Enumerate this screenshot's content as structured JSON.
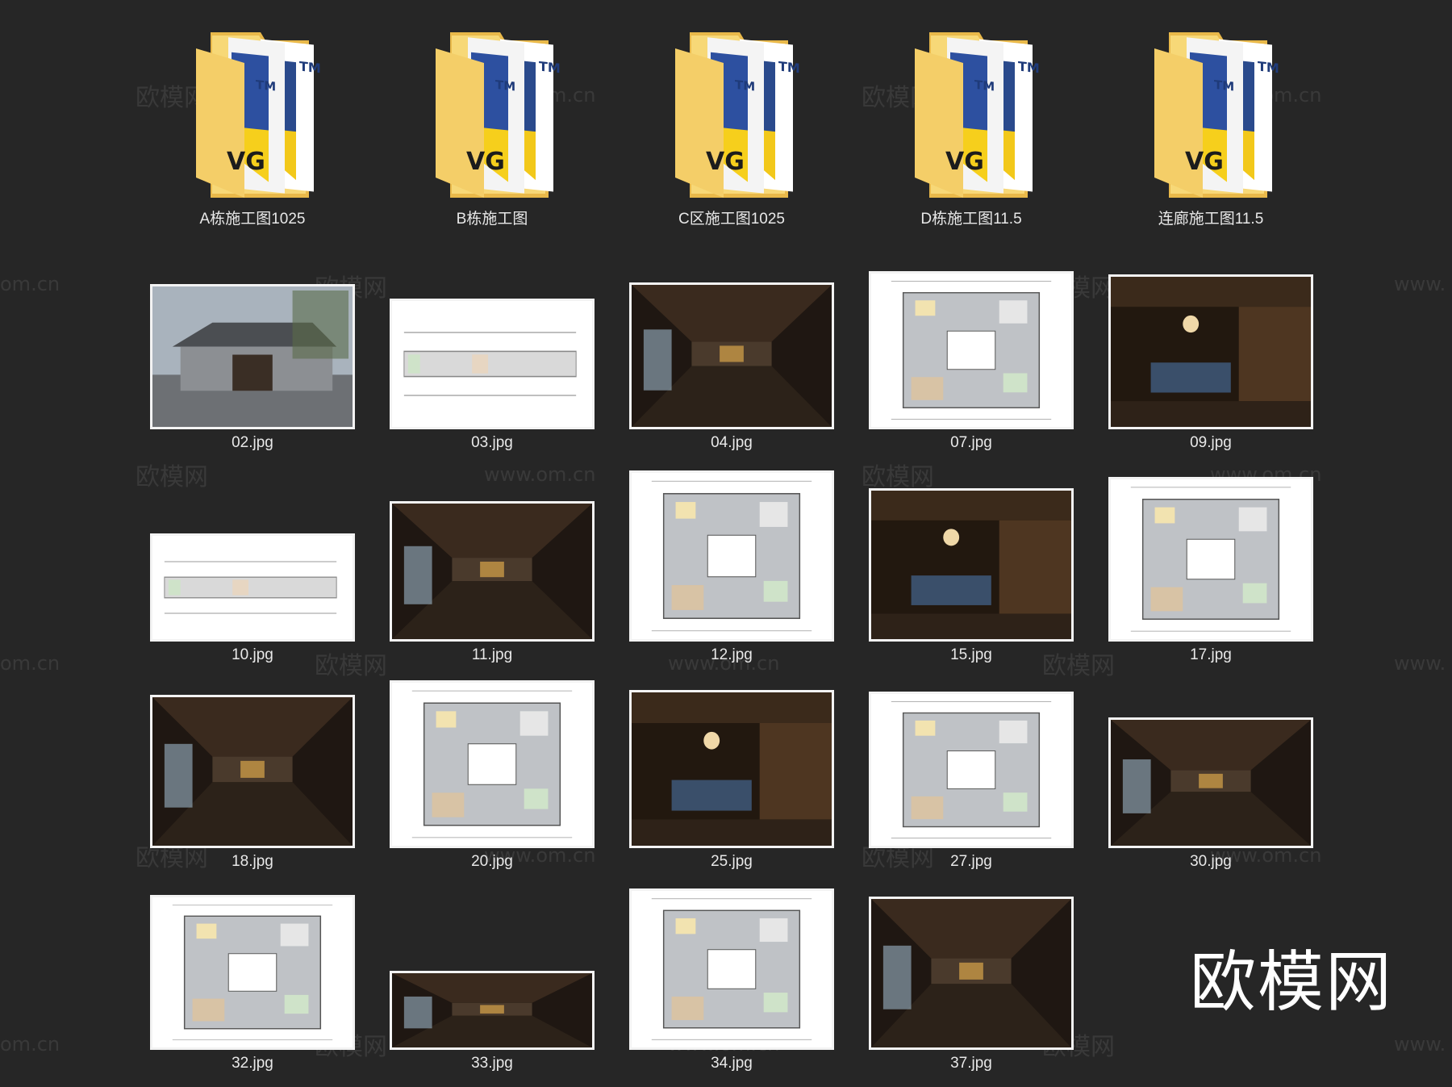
{
  "folders": [
    {
      "name": "A栋施工图1025"
    },
    {
      "name": "B栋施工图"
    },
    {
      "name": "C区施工图1025"
    },
    {
      "name": "D栋施工图11.5"
    },
    {
      "name": "连廊施工图11.5"
    }
  ],
  "files": [
    {
      "name": "02.jpg",
      "kind": "exterior-render"
    },
    {
      "name": "03.jpg",
      "kind": "long-plan"
    },
    {
      "name": "04.jpg",
      "kind": "corridor-render"
    },
    {
      "name": "07.jpg",
      "kind": "floor-plan"
    },
    {
      "name": "09.jpg",
      "kind": "dining-render"
    },
    {
      "name": "10.jpg",
      "kind": "long-plan"
    },
    {
      "name": "11.jpg",
      "kind": "hall-render"
    },
    {
      "name": "12.jpg",
      "kind": "floor-plan"
    },
    {
      "name": "15.jpg",
      "kind": "tea-room-render"
    },
    {
      "name": "17.jpg",
      "kind": "floor-plan"
    },
    {
      "name": "18.jpg",
      "kind": "corridor-render"
    },
    {
      "name": "20.jpg",
      "kind": "floor-plan"
    },
    {
      "name": "25.jpg",
      "kind": "bedroom-render"
    },
    {
      "name": "27.jpg",
      "kind": "floor-plan"
    },
    {
      "name": "30.jpg",
      "kind": "veranda-render"
    },
    {
      "name": "32.jpg",
      "kind": "floor-plan"
    },
    {
      "name": "33.jpg",
      "kind": "lobby-render"
    },
    {
      "name": "34.jpg",
      "kind": "floor-plan"
    },
    {
      "name": "37.jpg",
      "kind": "living-render"
    }
  ],
  "watermarks": {
    "site": "欧模网",
    "url": "www.om.cn",
    "url_fragment": "om.cn",
    "url_prefix": "www."
  },
  "brand_logo": "欧模网",
  "colors": {
    "background": "#262626",
    "folder_yellow": "#f5d26a",
    "folder_blue": "#2a4a8c",
    "label_text": "#e8e8e8"
  }
}
